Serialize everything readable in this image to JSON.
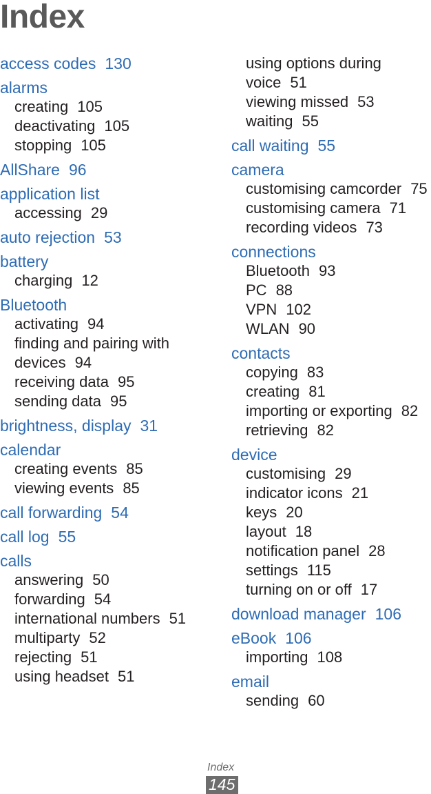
{
  "title": "Index",
  "colors": {
    "entry_blue": "#2e6cb4",
    "subentry_black": "#231f20",
    "title_gray": "#595959",
    "footer_gray": "#6d6d6d"
  },
  "footer": {
    "label": "Index",
    "page_number": "145"
  },
  "columns": [
    {
      "name": "left-column",
      "items": [
        {
          "type": "entry",
          "label": "access codes",
          "page": "130"
        },
        {
          "type": "entry",
          "label": "alarms",
          "page": ""
        },
        {
          "type": "subentry",
          "label": "creating",
          "page": "105"
        },
        {
          "type": "subentry",
          "label": "deactivating",
          "page": "105"
        },
        {
          "type": "subentry",
          "label": "stopping",
          "page": "105"
        },
        {
          "type": "entry",
          "label": "AllShare",
          "page": "96"
        },
        {
          "type": "entry",
          "label": "application list",
          "page": ""
        },
        {
          "type": "subentry",
          "label": "accessing",
          "page": "29"
        },
        {
          "type": "entry",
          "label": "auto rejection",
          "page": "53"
        },
        {
          "type": "entry",
          "label": "battery",
          "page": ""
        },
        {
          "type": "subentry",
          "label": "charging",
          "page": "12"
        },
        {
          "type": "entry",
          "label": "Bluetooth",
          "page": ""
        },
        {
          "type": "subentry",
          "label": "activating",
          "page": "94"
        },
        {
          "type": "subentry",
          "label": "finding and pairing with",
          "page": ""
        },
        {
          "type": "subentry",
          "label": "devices",
          "page": "94"
        },
        {
          "type": "subentry",
          "label": "receiving data",
          "page": "95"
        },
        {
          "type": "subentry",
          "label": "sending data",
          "page": "95"
        },
        {
          "type": "entry",
          "label": "brightness, display",
          "page": "31"
        },
        {
          "type": "entry",
          "label": "calendar",
          "page": ""
        },
        {
          "type": "subentry",
          "label": "creating events",
          "page": "85"
        },
        {
          "type": "subentry",
          "label": "viewing events",
          "page": "85"
        },
        {
          "type": "entry",
          "label": "call forwarding",
          "page": "54"
        },
        {
          "type": "entry",
          "label": "call log",
          "page": "55"
        },
        {
          "type": "entry",
          "label": "calls",
          "page": ""
        },
        {
          "type": "subentry",
          "label": "answering",
          "page": "50"
        },
        {
          "type": "subentry",
          "label": "forwarding",
          "page": "54"
        },
        {
          "type": "subentry",
          "label": "international numbers",
          "page": "51"
        },
        {
          "type": "subentry",
          "label": "multiparty",
          "page": "52"
        },
        {
          "type": "subentry",
          "label": "rejecting",
          "page": "51"
        },
        {
          "type": "subentry",
          "label": "using headset",
          "page": "51"
        }
      ]
    },
    {
      "name": "right-column",
      "items": [
        {
          "type": "subentry",
          "label": "using options during",
          "page": ""
        },
        {
          "type": "subentry",
          "label": "voice",
          "page": "51"
        },
        {
          "type": "subentry",
          "label": "viewing missed",
          "page": "53"
        },
        {
          "type": "subentry",
          "label": "waiting",
          "page": "55"
        },
        {
          "type": "entry",
          "label": "call waiting",
          "page": "55"
        },
        {
          "type": "entry",
          "label": "camera",
          "page": ""
        },
        {
          "type": "subentry",
          "label": "customising camcorder",
          "page": "75"
        },
        {
          "type": "subentry",
          "label": "customising camera",
          "page": "71"
        },
        {
          "type": "subentry",
          "label": "recording videos",
          "page": "73"
        },
        {
          "type": "entry",
          "label": "connections",
          "page": ""
        },
        {
          "type": "subentry",
          "label": "Bluetooth",
          "page": "93"
        },
        {
          "type": "subentry",
          "label": "PC",
          "page": "88"
        },
        {
          "type": "subentry",
          "label": "VPN",
          "page": "102"
        },
        {
          "type": "subentry",
          "label": "WLAN",
          "page": "90"
        },
        {
          "type": "entry",
          "label": "contacts",
          "page": ""
        },
        {
          "type": "subentry",
          "label": "copying",
          "page": "83"
        },
        {
          "type": "subentry",
          "label": "creating",
          "page": "81"
        },
        {
          "type": "subentry",
          "label": "importing or exporting",
          "page": "82"
        },
        {
          "type": "subentry",
          "label": "retrieving",
          "page": "82"
        },
        {
          "type": "entry",
          "label": "device",
          "page": ""
        },
        {
          "type": "subentry",
          "label": "customising",
          "page": "29"
        },
        {
          "type": "subentry",
          "label": "indicator icons",
          "page": "21"
        },
        {
          "type": "subentry",
          "label": "keys",
          "page": "20"
        },
        {
          "type": "subentry",
          "label": "layout",
          "page": "18"
        },
        {
          "type": "subentry",
          "label": "notification panel",
          "page": "28"
        },
        {
          "type": "subentry",
          "label": "settings",
          "page": "115"
        },
        {
          "type": "subentry",
          "label": "turning on or off",
          "page": "17"
        },
        {
          "type": "entry",
          "label": "download manager",
          "page": "106"
        },
        {
          "type": "entry",
          "label": "eBook",
          "page": "106"
        },
        {
          "type": "subentry",
          "label": "importing",
          "page": "108"
        },
        {
          "type": "entry",
          "label": "email",
          "page": ""
        },
        {
          "type": "subentry",
          "label": "sending",
          "page": "60"
        }
      ]
    }
  ]
}
